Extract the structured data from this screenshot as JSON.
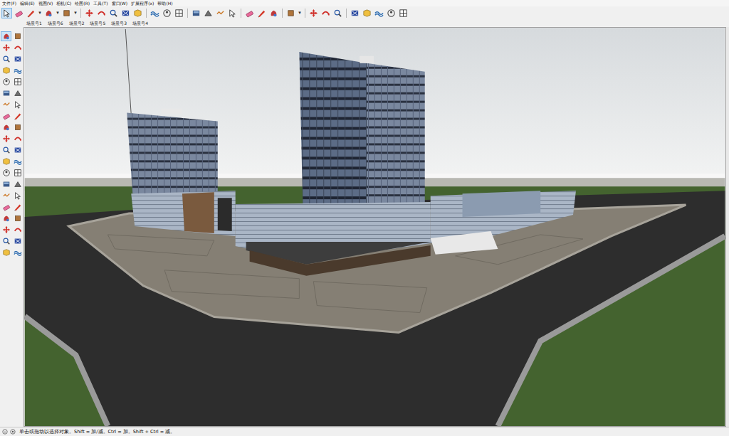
{
  "menu": [
    "文件(F)",
    "编辑(E)",
    "视图(V)",
    "相机(C)",
    "绘图(R)",
    "工具(T)",
    "窗口(W)",
    "扩展程序(x)",
    "帮助(H)"
  ],
  "toolbar": {
    "tools": [
      {
        "kind": "tool",
        "selected": true
      },
      {
        "kind": "tool",
        "selected": false
      },
      {
        "kind": "tool",
        "selected": false
      },
      {
        "kind": "dropdown",
        "label": "▾"
      },
      {
        "kind": "tool",
        "selected": false
      },
      {
        "kind": "dropdown",
        "label": "▾"
      },
      {
        "kind": "tool",
        "selected": false
      },
      {
        "kind": "dropdown",
        "label": "▾"
      },
      {
        "kind": "separator"
      },
      {
        "kind": "tool",
        "selected": false
      },
      {
        "kind": "tool",
        "selected": false
      },
      {
        "kind": "tool",
        "selected": false
      },
      {
        "kind": "tool",
        "selected": false
      },
      {
        "kind": "tool",
        "selected": false
      },
      {
        "kind": "separator"
      },
      {
        "kind": "tool",
        "selected": false
      },
      {
        "kind": "tool",
        "selected": false
      },
      {
        "kind": "tool",
        "selected": false
      },
      {
        "kind": "separator"
      },
      {
        "kind": "tool",
        "selected": false
      },
      {
        "kind": "tool",
        "selected": false
      },
      {
        "kind": "tool",
        "selected": false
      },
      {
        "kind": "tool",
        "selected": false
      },
      {
        "kind": "separator"
      },
      {
        "kind": "tool",
        "selected": false
      },
      {
        "kind": "tool",
        "selected": false
      },
      {
        "kind": "tool",
        "selected": false
      },
      {
        "kind": "separator"
      },
      {
        "kind": "tool",
        "selected": false
      },
      {
        "kind": "dropdown",
        "label": "▾"
      },
      {
        "kind": "separator"
      },
      {
        "kind": "tool",
        "selected": false
      },
      {
        "kind": "tool",
        "selected": false
      },
      {
        "kind": "tool",
        "selected": false
      },
      {
        "kind": "separator"
      },
      {
        "kind": "tool",
        "selected": false
      },
      {
        "kind": "tool",
        "selected": false
      },
      {
        "kind": "tool",
        "selected": false
      },
      {
        "kind": "tool",
        "selected": false
      },
      {
        "kind": "tool",
        "selected": false
      }
    ]
  },
  "scenes": [
    {
      "label": "场景号1",
      "selected": false
    },
    {
      "label": "场景号6",
      "selected": false
    },
    {
      "label": "场景号2",
      "selected": false
    },
    {
      "label": "场景号5",
      "selected": false
    },
    {
      "label": "场景号3",
      "selected": false
    },
    {
      "label": "场景号4",
      "selected": false
    }
  ],
  "left_toolbar": {
    "tools": [
      {
        "selected": true
      },
      {
        "selected": false
      },
      {
        "selected": false
      },
      {
        "selected": false
      },
      {
        "selected": false
      },
      {
        "selected": false
      },
      {
        "selected": false
      },
      {
        "selected": false
      },
      {
        "selected": false
      },
      {
        "selected": false
      },
      {
        "selected": false
      },
      {
        "selected": false
      },
      {
        "selected": false
      },
      {
        "selected": false
      },
      {
        "selected": false
      },
      {
        "selected": false
      },
      {
        "selected": false
      },
      {
        "selected": false
      },
      {
        "selected": false
      },
      {
        "selected": false
      },
      {
        "selected": false
      },
      {
        "selected": false
      },
      {
        "selected": false
      },
      {
        "selected": false
      },
      {
        "selected": false
      },
      {
        "selected": false
      },
      {
        "selected": false
      },
      {
        "selected": false
      },
      {
        "selected": false
      },
      {
        "selected": false
      },
      {
        "selected": false
      },
      {
        "selected": false
      },
      {
        "selected": false
      },
      {
        "selected": false
      },
      {
        "selected": false
      },
      {
        "selected": false
      },
      {
        "selected": false
      },
      {
        "selected": false
      },
      {
        "selected": false
      },
      {
        "selected": false
      }
    ]
  },
  "status_bar": {
    "text": "单击或拖动以选择对象。Shift = 加/减。Ctrl = 加。Shift + Ctrl = 减。"
  }
}
